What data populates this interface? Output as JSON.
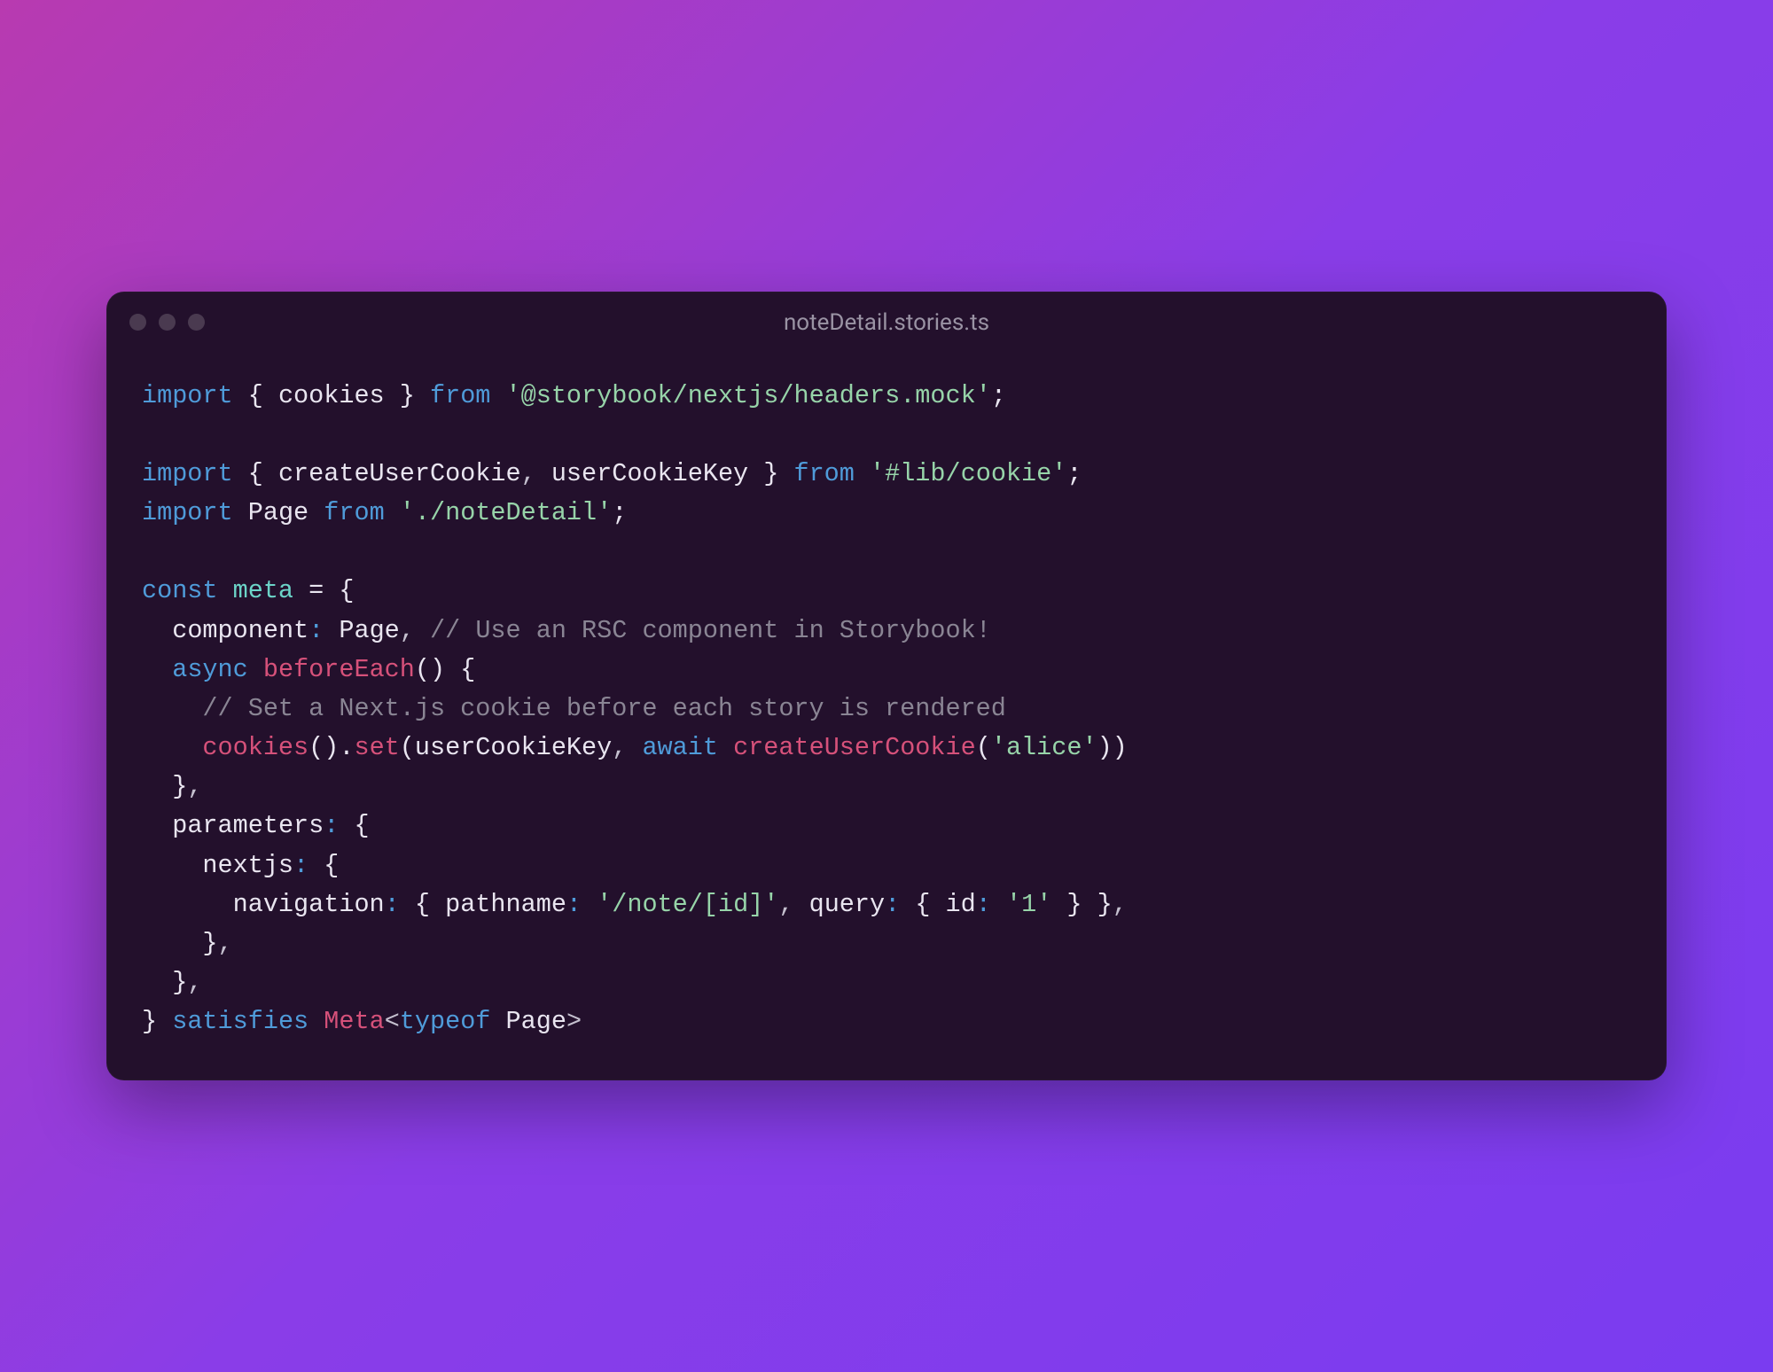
{
  "window": {
    "title": "noteDetail.stories.ts"
  },
  "code": {
    "l1_import": "import",
    "l1_brace_open": " { ",
    "l1_cookies": "cookies",
    "l1_brace_close": " } ",
    "l1_from": "from",
    "l1_sp": " ",
    "l1_str": "'@storybook/nextjs/headers.mock'",
    "l1_semicolon": ";",
    "l3_import": "import",
    "l3_brace_open": " { ",
    "l3_id1": "createUserCookie",
    "l3_comma": ", ",
    "l3_id2": "userCookieKey",
    "l3_brace_close": " } ",
    "l3_from": "from",
    "l3_sp": " ",
    "l3_str": "'#lib/cookie'",
    "l3_semicolon": ";",
    "l4_import": "import",
    "l4_sp1": " ",
    "l4_page": "Page",
    "l4_sp2": " ",
    "l4_from": "from",
    "l4_sp3": " ",
    "l4_str": "'./noteDetail'",
    "l4_semicolon": ";",
    "l6_const": "const",
    "l6_sp": " ",
    "l6_meta": "meta",
    "l6_eq": " = ",
    "l6_brace": "{",
    "l7_indent": "  ",
    "l7_key": "component",
    "l7_colon": ": ",
    "l7_val": "Page",
    "l7_comma": ", ",
    "l7_cmt": "// Use an RSC component in Storybook!",
    "l8_indent": "  ",
    "l8_async": "async",
    "l8_sp": " ",
    "l8_fn": "beforeEach",
    "l8_paren": "()",
    "l8_brace": " {",
    "l9_indent": "    ",
    "l9_cmt": "// Set a Next.js cookie before each story is rendered",
    "l10_indent": "    ",
    "l10_cookies": "cookies",
    "l10_paren1": "().",
    "l10_set": "set",
    "l10_paren2": "(",
    "l10_arg1": "userCookieKey",
    "l10_comma": ", ",
    "l10_await": "await",
    "l10_sp": " ",
    "l10_create": "createUserCookie",
    "l10_paren3": "(",
    "l10_str": "'alice'",
    "l10_paren4": "))",
    "l11_indent": "  ",
    "l11_close": "}",
    "l11_comma": ",",
    "l12_indent": "  ",
    "l12_key": "parameters",
    "l12_colon": ": ",
    "l12_brace": "{",
    "l13_indent": "    ",
    "l13_key": "nextjs",
    "l13_colon": ": ",
    "l13_brace": "{",
    "l14_indent": "      ",
    "l14_key": "navigation",
    "l14_colon": ": ",
    "l14_brace_open": "{ ",
    "l14_k1": "pathname",
    "l14_c1": ": ",
    "l14_v1": "'/note/[id]'",
    "l14_comma1": ", ",
    "l14_k2": "query",
    "l14_c2": ": ",
    "l14_brace2": "{ ",
    "l14_k3": "id",
    "l14_c3": ": ",
    "l14_v3": "'1'",
    "l14_brace2c": " }",
    "l14_brace_close": " }",
    "l14_end_comma": ",",
    "l15_indent": "    ",
    "l15_close": "}",
    "l15_comma": ",",
    "l16_indent": "  ",
    "l16_close": "}",
    "l16_comma": ",",
    "l17_close": "} ",
    "l17_satisfies": "satisfies",
    "l17_sp": " ",
    "l17_meta": "Meta",
    "l17_lt": "<",
    "l17_typeof": "typeof",
    "l17_sp2": " ",
    "l17_page": "Page",
    "l17_gt": ">"
  }
}
